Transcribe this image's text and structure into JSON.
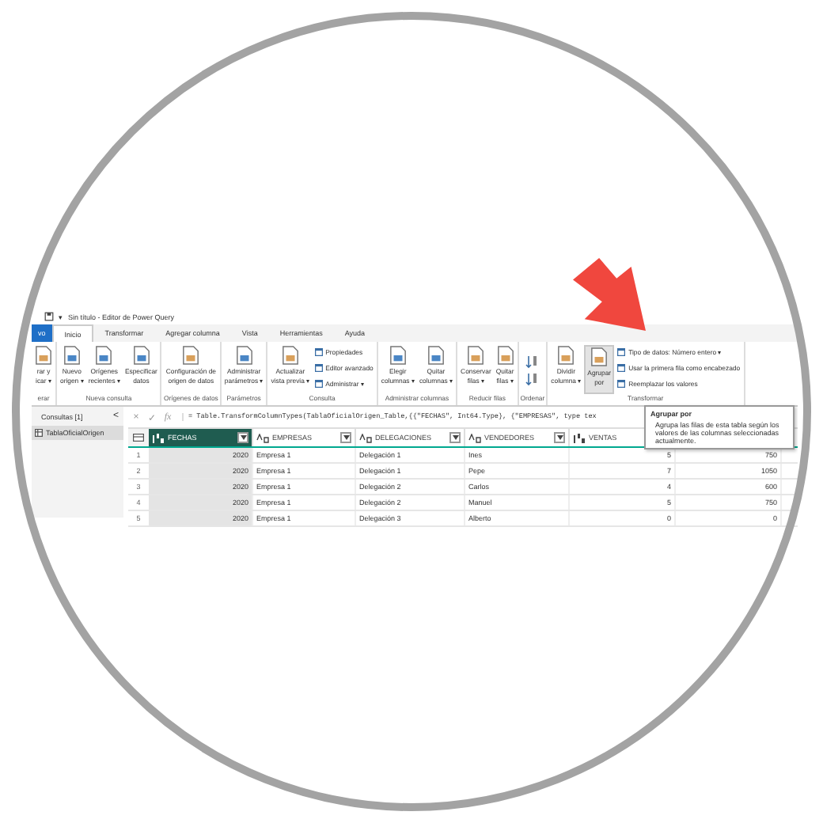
{
  "title_bar": {
    "title": "Sin título - Editor de Power Query",
    "quick_access": "▾"
  },
  "tabs": [
    {
      "label": "vo",
      "kind": "file",
      "selected": false
    },
    {
      "label": "Inicio",
      "kind": "tab",
      "selected": true
    },
    {
      "label": "Transformar",
      "kind": "tab",
      "selected": false
    },
    {
      "label": "Agregar columna",
      "kind": "tab",
      "selected": false
    },
    {
      "label": "Vista",
      "kind": "tab",
      "selected": false
    },
    {
      "label": "Herramientas",
      "kind": "tab",
      "selected": false
    },
    {
      "label": "Ayuda",
      "kind": "tab",
      "selected": false
    }
  ],
  "ribbon": {
    "groups": [
      {
        "label": "erar",
        "buttons": [
          {
            "kind": "large",
            "lines": [
              "rar y",
              "icar ▾"
            ],
            "hovered": false
          }
        ]
      },
      {
        "label": "Nueva consulta",
        "buttons": [
          {
            "kind": "large",
            "lines": [
              "Nuevo",
              "origen ▾"
            ],
            "hovered": false
          },
          {
            "kind": "large",
            "lines": [
              "Orígenes",
              "recientes ▾"
            ],
            "hovered": false
          },
          {
            "kind": "large",
            "lines": [
              "Especificar",
              "datos"
            ],
            "hovered": false
          }
        ]
      },
      {
        "label": "Orígenes de datos",
        "buttons": [
          {
            "kind": "large",
            "lines": [
              "Configuración de",
              "origen de datos"
            ],
            "hovered": false
          }
        ]
      },
      {
        "label": "Parámetros",
        "buttons": [
          {
            "kind": "large",
            "lines": [
              "Administrar",
              "parámetros ▾"
            ],
            "hovered": false
          }
        ]
      },
      {
        "label": "Consulta",
        "buttons": [
          {
            "kind": "large",
            "lines": [
              "Actualizar",
              "vista previa ▾"
            ],
            "hovered": false
          },
          {
            "kind": "small",
            "lines": [
              "Propiedades"
            ],
            "hovered": false
          },
          {
            "kind": "small",
            "lines": [
              "Editor avanzado"
            ],
            "hovered": false
          },
          {
            "kind": "small",
            "lines": [
              "Administrar ▾"
            ],
            "hovered": false
          }
        ]
      },
      {
        "label": "Administrar columnas",
        "buttons": [
          {
            "kind": "large",
            "lines": [
              "Elegir",
              "columnas ▾"
            ],
            "hovered": false
          },
          {
            "kind": "large",
            "lines": [
              "Quitar",
              "columnas ▾"
            ],
            "hovered": false
          }
        ]
      },
      {
        "label": "Reducir filas",
        "buttons": [
          {
            "kind": "large",
            "lines": [
              "Conservar",
              "filas ▾"
            ],
            "hovered": false
          },
          {
            "kind": "large",
            "lines": [
              "Quitar",
              "filas ▾"
            ],
            "hovered": false
          }
        ]
      },
      {
        "label": "Ordenar",
        "buttons": [
          {
            "kind": "sort",
            "hovered": false
          }
        ]
      },
      {
        "label": "Transformar",
        "buttons": [
          {
            "kind": "large",
            "lines": [
              "Dividir",
              "columna ▾"
            ],
            "hovered": false
          },
          {
            "kind": "large",
            "lines": [
              "Agrupar",
              "por"
            ],
            "hovered": true
          },
          {
            "kind": "small",
            "lines": [
              "Tipo de datos: Número entero ▾"
            ],
            "hovered": false
          },
          {
            "kind": "small",
            "lines": [
              "Usar la primera fila como encabezado"
            ],
            "hovered": false
          },
          {
            "kind": "small",
            "lines": [
              "Reemplazar los valores"
            ],
            "hovered": false
          }
        ]
      }
    ]
  },
  "queries": {
    "title": "Consultas [1]",
    "collapse": "<",
    "items": [
      {
        "label": "TablaOficialOrigen",
        "selected": true
      }
    ]
  },
  "formula_bar": {
    "cancel": "×",
    "confirm": "✓",
    "fx": "fx",
    "formula": "= Table.TransformColumnTypes(TablaOficialOrigen_Table,{{\"FECHAS\", Int64.Type}, {\"EMPRESAS\", type tex"
  },
  "table": {
    "columns": [
      {
        "label": "FECHAS",
        "kind": "number",
        "selected": true
      },
      {
        "label": "EMPRESAS",
        "kind": "text",
        "selected": false
      },
      {
        "label": "DELEGACIONES",
        "kind": "text",
        "selected": false
      },
      {
        "label": "VENDEDORES",
        "kind": "text",
        "selected": false
      },
      {
        "label": "VENTAS",
        "kind": "number",
        "selected": false
      },
      {
        "kind": "number"
      }
    ],
    "rows": [
      {
        "number": "1",
        "cells": [
          "2020",
          "Empresa 1",
          "Delegación 1",
          "Ines",
          "5",
          "750"
        ]
      },
      {
        "number": "2",
        "cells": [
          "2020",
          "Empresa 1",
          "Delegación 1",
          "Pepe",
          "7",
          "1050"
        ]
      },
      {
        "number": "3",
        "cells": [
          "2020",
          "Empresa 1",
          "Delegación 2",
          "Carlos",
          "4",
          "600"
        ]
      },
      {
        "number": "4",
        "cells": [
          "2020",
          "Empresa 1",
          "Delegación 2",
          "Manuel",
          "5",
          "750"
        ]
      },
      {
        "number": "5",
        "cells": [
          "2020",
          "Empresa 1",
          "Delegación 3",
          "Alberto",
          "0",
          "0"
        ]
      }
    ]
  },
  "tooltip": {
    "title": "Agrupar por",
    "text": "Agrupa las filas de esta tabla según los valores de las columnas seleccionadas actualmente."
  }
}
